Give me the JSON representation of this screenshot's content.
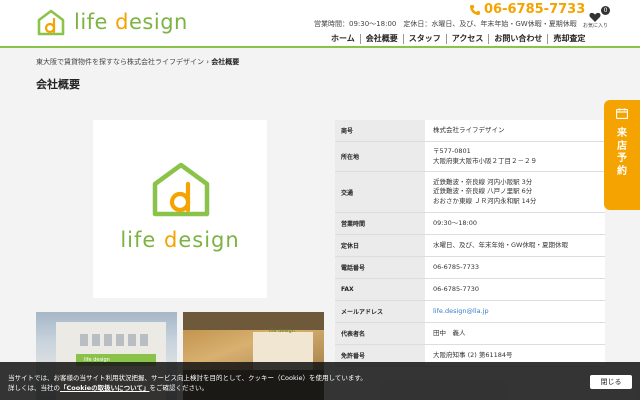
{
  "header": {
    "logo": {
      "text_main": "life ",
      "text_accent": "d",
      "text_rest": "esign",
      "icon": "house-d-logo-icon"
    },
    "phone": "06-6785-7733",
    "hours": "営業時間：09:30～18:00　定休日：水曜日、及び、年末年始・GW休暇・夏期休暇",
    "favorite": {
      "label": "お気に入り",
      "count": "0",
      "icon": "heart-icon"
    },
    "nav": [
      "ホーム",
      "会社概要",
      "スタッフ",
      "アクセス",
      "お問い合わせ",
      "売却査定"
    ]
  },
  "breadcrumb": {
    "parent": "東大阪で賃貸物件を探すなら株式会社ライフデザイン",
    "separator": "›",
    "current": "会社概要"
  },
  "page_title": "会社概要",
  "company_logo": {
    "text_main": "life ",
    "text_accent": "d",
    "text_rest": "esign"
  },
  "photos": {
    "sign_text": "life design"
  },
  "company_info": [
    {
      "label": "商号",
      "lines": [
        "株式会社ライフデザイン"
      ]
    },
    {
      "label": "所在地",
      "lines": [
        "〒577-0801",
        "大阪府東大阪市小阪２丁目２－２９"
      ]
    },
    {
      "label": "交通",
      "lines": [
        "近鉄難波・奈良線 河内小阪駅 3分",
        "近鉄難波・奈良線 八戸ノ里駅 6分",
        "おおさか東線 ＪＲ河内永和駅 14分"
      ]
    },
    {
      "label": "営業時間",
      "lines": [
        "09:30～18:00"
      ]
    },
    {
      "label": "定休日",
      "lines": [
        "水曜日、及び、年末年始・GW休暇・夏期休暇"
      ]
    },
    {
      "label": "電話番号",
      "lines": [
        "06-6785-7733"
      ]
    },
    {
      "label": "FAX",
      "lines": [
        "06-6785-7730"
      ]
    },
    {
      "label": "メールアドレス",
      "lines": [
        "life.design@lla.jp"
      ],
      "link": true
    },
    {
      "label": "代表者名",
      "lines": [
        "田中　義人"
      ]
    },
    {
      "label": "免許番号",
      "lines": [
        "大阪府知事 (2) 第61184号"
      ]
    }
  ],
  "side_tab": {
    "label": "来店予約",
    "icon": "calendar-icon"
  },
  "cookie": {
    "line1": "当サイトでは、お客様の当サイト利用状況把握、サービス向上検討を目的として、クッキー（Cookie）を使用しています。",
    "line2_pre": "詳しくは、当社の",
    "link": "「Cookieの取扱いについて」",
    "line2_post": "をご確認ください。",
    "close_label": "閉じる"
  },
  "colors": {
    "brand_green": "#8bc34a",
    "brand_orange": "#f5a300",
    "link_blue": "#3b7ec9"
  }
}
